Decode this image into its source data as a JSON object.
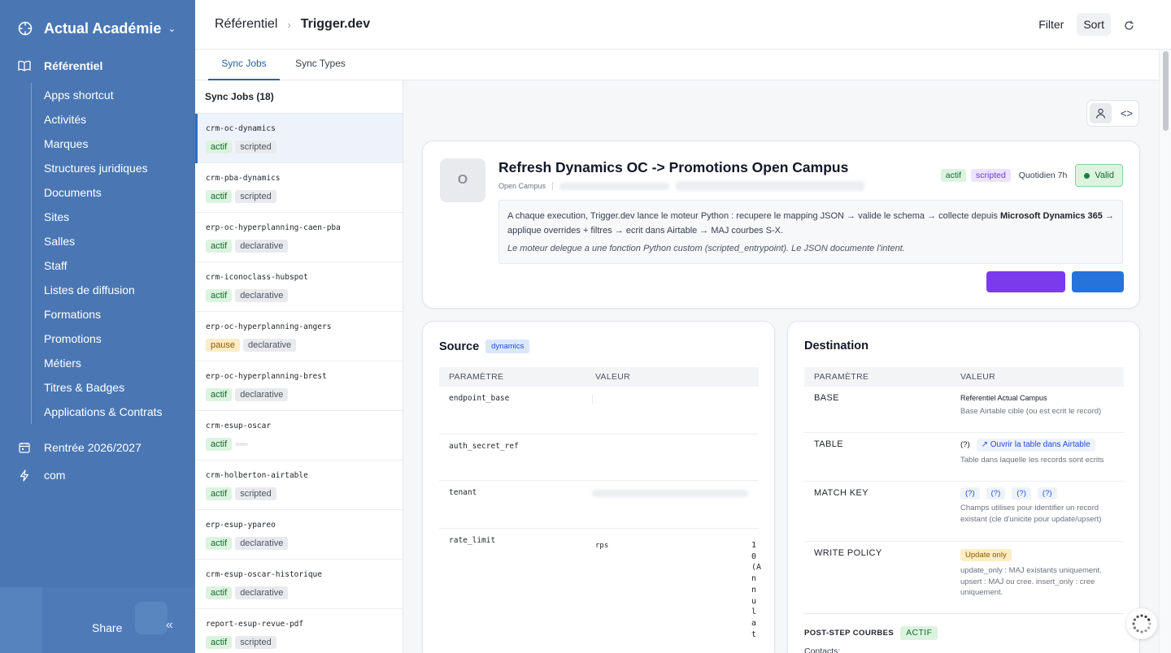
{
  "sidebar": {
    "workspace": "Actual Académie",
    "section_main": "Référentiel",
    "items": [
      "Apps shortcut",
      "Activités",
      "Marques",
      "Structures juridiques",
      "Documents",
      "Sites",
      "Salles",
      "Staff",
      "Listes de diffusion",
      "Formations",
      "Promotions",
      "Métiers",
      "Titres & Badges",
      "Applications & Contrats"
    ],
    "section_rentree": "Rentrée 2026/2027",
    "section_com": "com",
    "share": "Share"
  },
  "header": {
    "breadcrumb_root": "Référentiel",
    "breadcrumb_current": "Trigger.dev",
    "filter": "Filter",
    "sort": "Sort"
  },
  "tabs": [
    "Sync Jobs",
    "Sync Types"
  ],
  "list": {
    "title": "Sync Jobs (18)",
    "jobs": [
      {
        "name": "crm-oc-dynamics",
        "status": "actif",
        "mode": "scripted"
      },
      {
        "name": "crm-pba-dynamics",
        "status": "actif",
        "mode": "scripted"
      },
      {
        "name": "erp-oc-hyperplanning-caen-pba",
        "status": "actif",
        "mode": "declarative"
      },
      {
        "name": "crm-iconoclass-hubspot",
        "status": "actif",
        "mode": "declarative"
      },
      {
        "name": "erp-oc-hyperplanning-angers",
        "status": "pause",
        "mode": "declarative"
      },
      {
        "name": "erp-oc-hyperplanning-brest",
        "status": "actif",
        "mode": "declarative"
      },
      {
        "name": "crm-esup-oscar",
        "status": "actif",
        "mode": ""
      },
      {
        "name": "crm-holberton-airtable",
        "status": "actif",
        "mode": "scripted"
      },
      {
        "name": "erp-esup-ypareo",
        "status": "actif",
        "mode": "declarative"
      },
      {
        "name": "crm-esup-oscar-historique",
        "status": "actif",
        "mode": "declarative"
      },
      {
        "name": "report-esup-revue-pdf",
        "status": "actif",
        "mode": "scripted"
      }
    ]
  },
  "detail": {
    "avatar_letter": "O",
    "title": "Refresh Dynamics OC -> Promotions Open Campus",
    "subtitle": "Open Campus",
    "badge_status": "actif",
    "badge_mode": "scripted",
    "schedule": "Quotidien 7h",
    "validity": "Valid",
    "desc_part1": "A chaque execution, Trigger.dev lance le moteur Python : recupere le mapping JSON → valide le schema → collecte depuis ",
    "desc_bold": "Microsoft Dynamics 365",
    "desc_part2": " → applique overrides + filtres → ecrit dans Airtable → MAJ courbes S-X.",
    "desc_italic": "Le moteur delegue a une fonction Python custom (scripted_entrypoint). Le JSON documente l'intent."
  },
  "source": {
    "title": "Source",
    "badge": "dynamics",
    "col_param": "PARAMÈTRE",
    "col_value": "VALEUR",
    "rows": [
      "endpoint_base",
      "auth_secret_ref",
      "tenant",
      "rate_limit"
    ],
    "rate_limit_key": "rps",
    "rate_limit_value_chars": [
      "1",
      "0",
      "(A",
      "n",
      "n",
      "u",
      "l",
      "a",
      "t"
    ]
  },
  "destination": {
    "title": "Destination",
    "col_param": "PARAMÈTRE",
    "col_value": "VALEUR",
    "base_label": "BASE",
    "base_value": "Referentiel Actual Campus",
    "base_help": "Base Airtable cible (ou est ecrit le record)",
    "table_label": "TABLE",
    "table_value": "(?)",
    "table_link": "↗ Ouvrir la table dans Airtable",
    "table_help": "Table dans laquelle les records sont ecrits",
    "match_label": "MATCH KEY",
    "match_values": [
      "(?)",
      "(?)",
      "(?)",
      "(?)"
    ],
    "match_help": "Champs utilises pour identifier un record existant (cle d'unicite pour update/upsert)",
    "policy_label": "WRITE POLICY",
    "policy_value": "Update only",
    "policy_help": "update_only : MAJ existants uniquement. upsert : MAJ ou cree. insert_only : cree uniquement.",
    "post_step": "POST-STEP COURBES",
    "post_badge": "ACTIF",
    "contacts": "Contacts:"
  }
}
